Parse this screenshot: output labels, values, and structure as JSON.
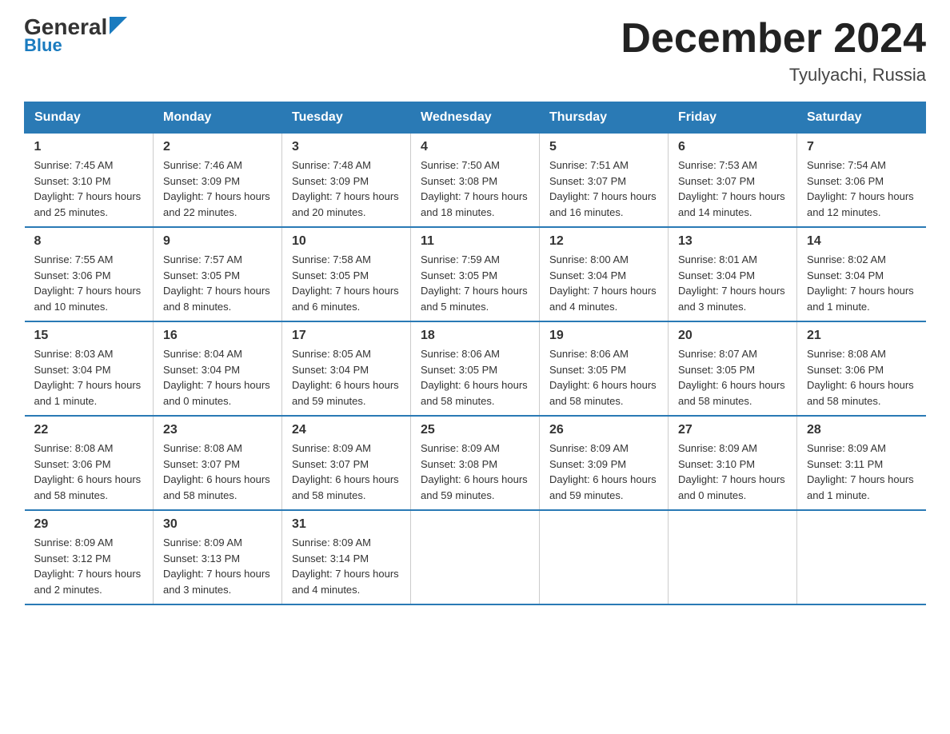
{
  "header": {
    "logo_general": "General",
    "logo_blue": "Blue",
    "month_title": "December 2024",
    "location": "Tyulyachi, Russia"
  },
  "days_of_week": [
    "Sunday",
    "Monday",
    "Tuesday",
    "Wednesday",
    "Thursday",
    "Friday",
    "Saturday"
  ],
  "weeks": [
    [
      {
        "day": "1",
        "sunrise": "7:45 AM",
        "sunset": "3:10 PM",
        "daylight": "7 hours and 25 minutes."
      },
      {
        "day": "2",
        "sunrise": "7:46 AM",
        "sunset": "3:09 PM",
        "daylight": "7 hours and 22 minutes."
      },
      {
        "day": "3",
        "sunrise": "7:48 AM",
        "sunset": "3:09 PM",
        "daylight": "7 hours and 20 minutes."
      },
      {
        "day": "4",
        "sunrise": "7:50 AM",
        "sunset": "3:08 PM",
        "daylight": "7 hours and 18 minutes."
      },
      {
        "day": "5",
        "sunrise": "7:51 AM",
        "sunset": "3:07 PM",
        "daylight": "7 hours and 16 minutes."
      },
      {
        "day": "6",
        "sunrise": "7:53 AM",
        "sunset": "3:07 PM",
        "daylight": "7 hours and 14 minutes."
      },
      {
        "day": "7",
        "sunrise": "7:54 AM",
        "sunset": "3:06 PM",
        "daylight": "7 hours and 12 minutes."
      }
    ],
    [
      {
        "day": "8",
        "sunrise": "7:55 AM",
        "sunset": "3:06 PM",
        "daylight": "7 hours and 10 minutes."
      },
      {
        "day": "9",
        "sunrise": "7:57 AM",
        "sunset": "3:05 PM",
        "daylight": "7 hours and 8 minutes."
      },
      {
        "day": "10",
        "sunrise": "7:58 AM",
        "sunset": "3:05 PM",
        "daylight": "7 hours and 6 minutes."
      },
      {
        "day": "11",
        "sunrise": "7:59 AM",
        "sunset": "3:05 PM",
        "daylight": "7 hours and 5 minutes."
      },
      {
        "day": "12",
        "sunrise": "8:00 AM",
        "sunset": "3:04 PM",
        "daylight": "7 hours and 4 minutes."
      },
      {
        "day": "13",
        "sunrise": "8:01 AM",
        "sunset": "3:04 PM",
        "daylight": "7 hours and 3 minutes."
      },
      {
        "day": "14",
        "sunrise": "8:02 AM",
        "sunset": "3:04 PM",
        "daylight": "7 hours and 1 minute."
      }
    ],
    [
      {
        "day": "15",
        "sunrise": "8:03 AM",
        "sunset": "3:04 PM",
        "daylight": "7 hours and 1 minute."
      },
      {
        "day": "16",
        "sunrise": "8:04 AM",
        "sunset": "3:04 PM",
        "daylight": "7 hours and 0 minutes."
      },
      {
        "day": "17",
        "sunrise": "8:05 AM",
        "sunset": "3:04 PM",
        "daylight": "6 hours and 59 minutes."
      },
      {
        "day": "18",
        "sunrise": "8:06 AM",
        "sunset": "3:05 PM",
        "daylight": "6 hours and 58 minutes."
      },
      {
        "day": "19",
        "sunrise": "8:06 AM",
        "sunset": "3:05 PM",
        "daylight": "6 hours and 58 minutes."
      },
      {
        "day": "20",
        "sunrise": "8:07 AM",
        "sunset": "3:05 PM",
        "daylight": "6 hours and 58 minutes."
      },
      {
        "day": "21",
        "sunrise": "8:08 AM",
        "sunset": "3:06 PM",
        "daylight": "6 hours and 58 minutes."
      }
    ],
    [
      {
        "day": "22",
        "sunrise": "8:08 AM",
        "sunset": "3:06 PM",
        "daylight": "6 hours and 58 minutes."
      },
      {
        "day": "23",
        "sunrise": "8:08 AM",
        "sunset": "3:07 PM",
        "daylight": "6 hours and 58 minutes."
      },
      {
        "day": "24",
        "sunrise": "8:09 AM",
        "sunset": "3:07 PM",
        "daylight": "6 hours and 58 minutes."
      },
      {
        "day": "25",
        "sunrise": "8:09 AM",
        "sunset": "3:08 PM",
        "daylight": "6 hours and 59 minutes."
      },
      {
        "day": "26",
        "sunrise": "8:09 AM",
        "sunset": "3:09 PM",
        "daylight": "6 hours and 59 minutes."
      },
      {
        "day": "27",
        "sunrise": "8:09 AM",
        "sunset": "3:10 PM",
        "daylight": "7 hours and 0 minutes."
      },
      {
        "day": "28",
        "sunrise": "8:09 AM",
        "sunset": "3:11 PM",
        "daylight": "7 hours and 1 minute."
      }
    ],
    [
      {
        "day": "29",
        "sunrise": "8:09 AM",
        "sunset": "3:12 PM",
        "daylight": "7 hours and 2 minutes."
      },
      {
        "day": "30",
        "sunrise": "8:09 AM",
        "sunset": "3:13 PM",
        "daylight": "7 hours and 3 minutes."
      },
      {
        "day": "31",
        "sunrise": "8:09 AM",
        "sunset": "3:14 PM",
        "daylight": "7 hours and 4 minutes."
      },
      null,
      null,
      null,
      null
    ]
  ],
  "labels": {
    "sunrise": "Sunrise:",
    "sunset": "Sunset:",
    "daylight": "Daylight:"
  }
}
